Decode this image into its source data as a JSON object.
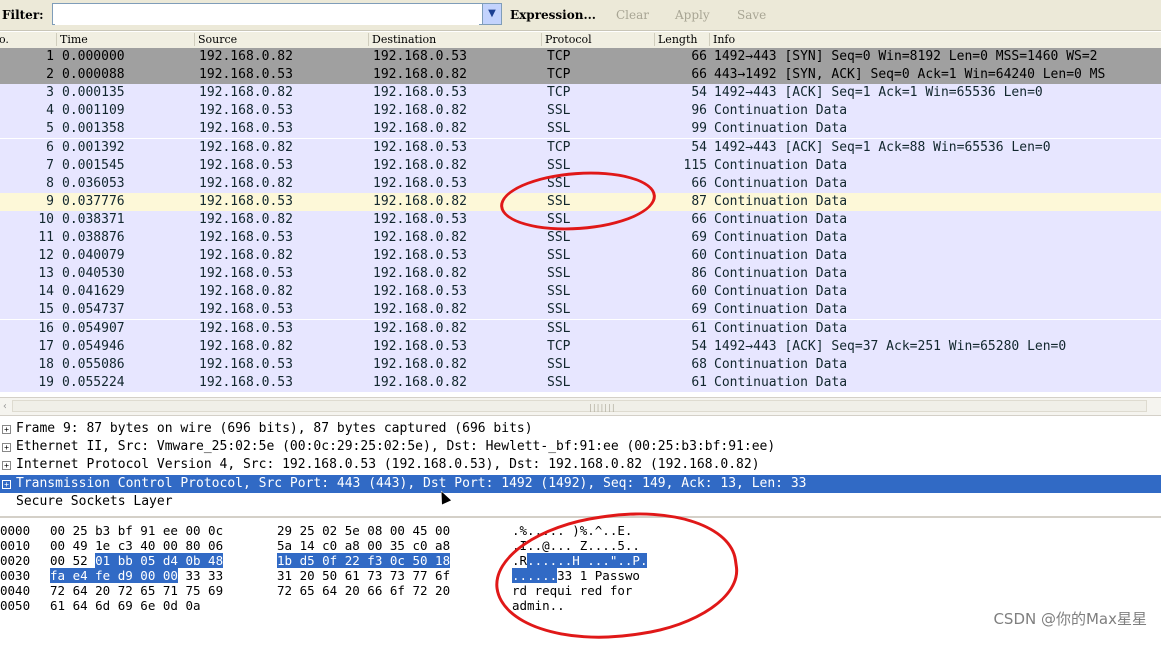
{
  "filter": {
    "label": "Filter:",
    "value": "",
    "expression_label": "Expression...",
    "clear_label": "Clear",
    "apply_label": "Apply",
    "save_label": "Save"
  },
  "packet_list": {
    "columns": [
      "o.",
      "Time",
      "Source",
      "Destination",
      "Protocol",
      "Length",
      "Info"
    ],
    "rows": [
      {
        "no": "1",
        "time": "0.000000",
        "src": "192.168.0.82",
        "dst": "192.168.0.53",
        "proto": "TCP",
        "len": "66",
        "info": "1492→443 [SYN] Seq=0 Win=8192 Len=0 MSS=1460 WS=2"
      },
      {
        "no": "2",
        "time": "0.000088",
        "src": "192.168.0.53",
        "dst": "192.168.0.82",
        "proto": "TCP",
        "len": "66",
        "info": "443→1492 [SYN, ACK] Seq=0 Ack=1 Win=64240 Len=0 MS"
      },
      {
        "no": "3",
        "time": "0.000135",
        "src": "192.168.0.82",
        "dst": "192.168.0.53",
        "proto": "TCP",
        "len": "54",
        "info": "1492→443 [ACK] Seq=1 Ack=1 Win=65536 Len=0"
      },
      {
        "no": "4",
        "time": "0.001109",
        "src": "192.168.0.53",
        "dst": "192.168.0.82",
        "proto": "SSL",
        "len": "96",
        "info": "Continuation Data"
      },
      {
        "no": "5",
        "time": "0.001358",
        "src": "192.168.0.53",
        "dst": "192.168.0.82",
        "proto": "SSL",
        "len": "99",
        "info": "Continuation Data"
      },
      {
        "no": "6",
        "time": "0.001392",
        "src": "192.168.0.82",
        "dst": "192.168.0.53",
        "proto": "TCP",
        "len": "54",
        "info": "1492→443 [ACK] Seq=1 Ack=88 Win=65536 Len=0"
      },
      {
        "no": "7",
        "time": "0.001545",
        "src": "192.168.0.53",
        "dst": "192.168.0.82",
        "proto": "SSL",
        "len": "115",
        "info": "Continuation Data"
      },
      {
        "no": "8",
        "time": "0.036053",
        "src": "192.168.0.82",
        "dst": "192.168.0.53",
        "proto": "SSL",
        "len": "66",
        "info": "Continuation Data"
      },
      {
        "no": "9",
        "time": "0.037776",
        "src": "192.168.0.53",
        "dst": "192.168.0.82",
        "proto": "SSL",
        "len": "87",
        "info": "Continuation Data"
      },
      {
        "no": "10",
        "time": "0.038371",
        "src": "192.168.0.82",
        "dst": "192.168.0.53",
        "proto": "SSL",
        "len": "66",
        "info": "Continuation Data"
      },
      {
        "no": "11",
        "time": "0.038876",
        "src": "192.168.0.53",
        "dst": "192.168.0.82",
        "proto": "SSL",
        "len": "69",
        "info": "Continuation Data"
      },
      {
        "no": "12",
        "time": "0.040079",
        "src": "192.168.0.82",
        "dst": "192.168.0.53",
        "proto": "SSL",
        "len": "60",
        "info": "Continuation Data"
      },
      {
        "no": "13",
        "time": "0.040530",
        "src": "192.168.0.53",
        "dst": "192.168.0.82",
        "proto": "SSL",
        "len": "86",
        "info": "Continuation Data"
      },
      {
        "no": "14",
        "time": "0.041629",
        "src": "192.168.0.82",
        "dst": "192.168.0.53",
        "proto": "SSL",
        "len": "60",
        "info": "Continuation Data"
      },
      {
        "no": "15",
        "time": "0.054737",
        "src": "192.168.0.53",
        "dst": "192.168.0.82",
        "proto": "SSL",
        "len": "69",
        "info": "Continuation Data"
      },
      {
        "no": "16",
        "time": "0.054907",
        "src": "192.168.0.53",
        "dst": "192.168.0.82",
        "proto": "SSL",
        "len": "61",
        "info": "Continuation Data"
      },
      {
        "no": "17",
        "time": "0.054946",
        "src": "192.168.0.82",
        "dst": "192.168.0.53",
        "proto": "TCP",
        "len": "54",
        "info": "1492→443 [ACK] Seq=37 Ack=251 Win=65280 Len=0"
      },
      {
        "no": "18",
        "time": "0.055086",
        "src": "192.168.0.53",
        "dst": "192.168.0.82",
        "proto": "SSL",
        "len": "68",
        "info": "Continuation Data"
      },
      {
        "no": "19",
        "time": "0.055224",
        "src": "192.168.0.53",
        "dst": "192.168.0.82",
        "proto": "SSL",
        "len": "61",
        "info": "Continuation Data"
      }
    ]
  },
  "details": [
    {
      "expander": "+",
      "text": "Frame 9: 87 bytes on wire (696 bits), 87 bytes captured (696 bits)"
    },
    {
      "expander": "+",
      "text": "Ethernet II, Src: Vmware_25:02:5e (00:0c:29:25:02:5e), Dst: Hewlett-_bf:91:ee (00:25:b3:bf:91:ee)"
    },
    {
      "expander": "+",
      "text": "Internet Protocol Version 4, Src: 192.168.0.53 (192.168.0.53), Dst: 192.168.0.82 (192.168.0.82)"
    },
    {
      "expander": "+",
      "text": "Transmission Control Protocol, Src Port: 443 (443), Dst Port: 1492 (1492), Seq: 149, Ack: 13, Len: 33"
    },
    {
      "expander": "",
      "text": "Secure Sockets Layer"
    }
  ],
  "hex": [
    {
      "off": "0000",
      "b1": "00 25 b3 bf 91 ee 00 0c",
      "b2": "29 25 02 5e 08 00 45 00",
      "a1": ".%..... )%.^..E."
    },
    {
      "off": "0010",
      "b1": "00 49 1e c3 40 00 80 06",
      "b2": "5a 14 c0 a8 00 35 c0 a8",
      "a1": ".I..@... Z....5.."
    },
    {
      "off": "0020",
      "b1": "00 52 ",
      "b1h": "01 bb 05 d4 0b 48",
      "b2h": "1b d5 0f 22 f3 0c 50 18",
      "a1": ".R",
      "a1h": "......H ...\"..P."
    },
    {
      "off": "0030",
      "b1h": "fa e4 fe d9 00 00",
      "b1": " 33 33",
      "b2": "31 20 50 61 73 73 77 6f",
      "a1h": "......",
      "a1": "33 1 Passwo"
    },
    {
      "off": "0040",
      "b1": "72 64 20 72 65 71 75 69",
      "b2": "72 65 64 20 66 6f 72 20",
      "a1": "rd requi red for"
    },
    {
      "off": "0050",
      "b1": "61 64 6d 69 6e 0d 0a",
      "b2": "",
      "a1": "admin.."
    }
  ],
  "watermark": "CSDN @你的Max星星",
  "colors": {
    "selected_row": "#316ac5",
    "tcp_row": "#a0a0a0",
    "ssl_row": "#e7e6ff",
    "annotation": "#e01818"
  }
}
